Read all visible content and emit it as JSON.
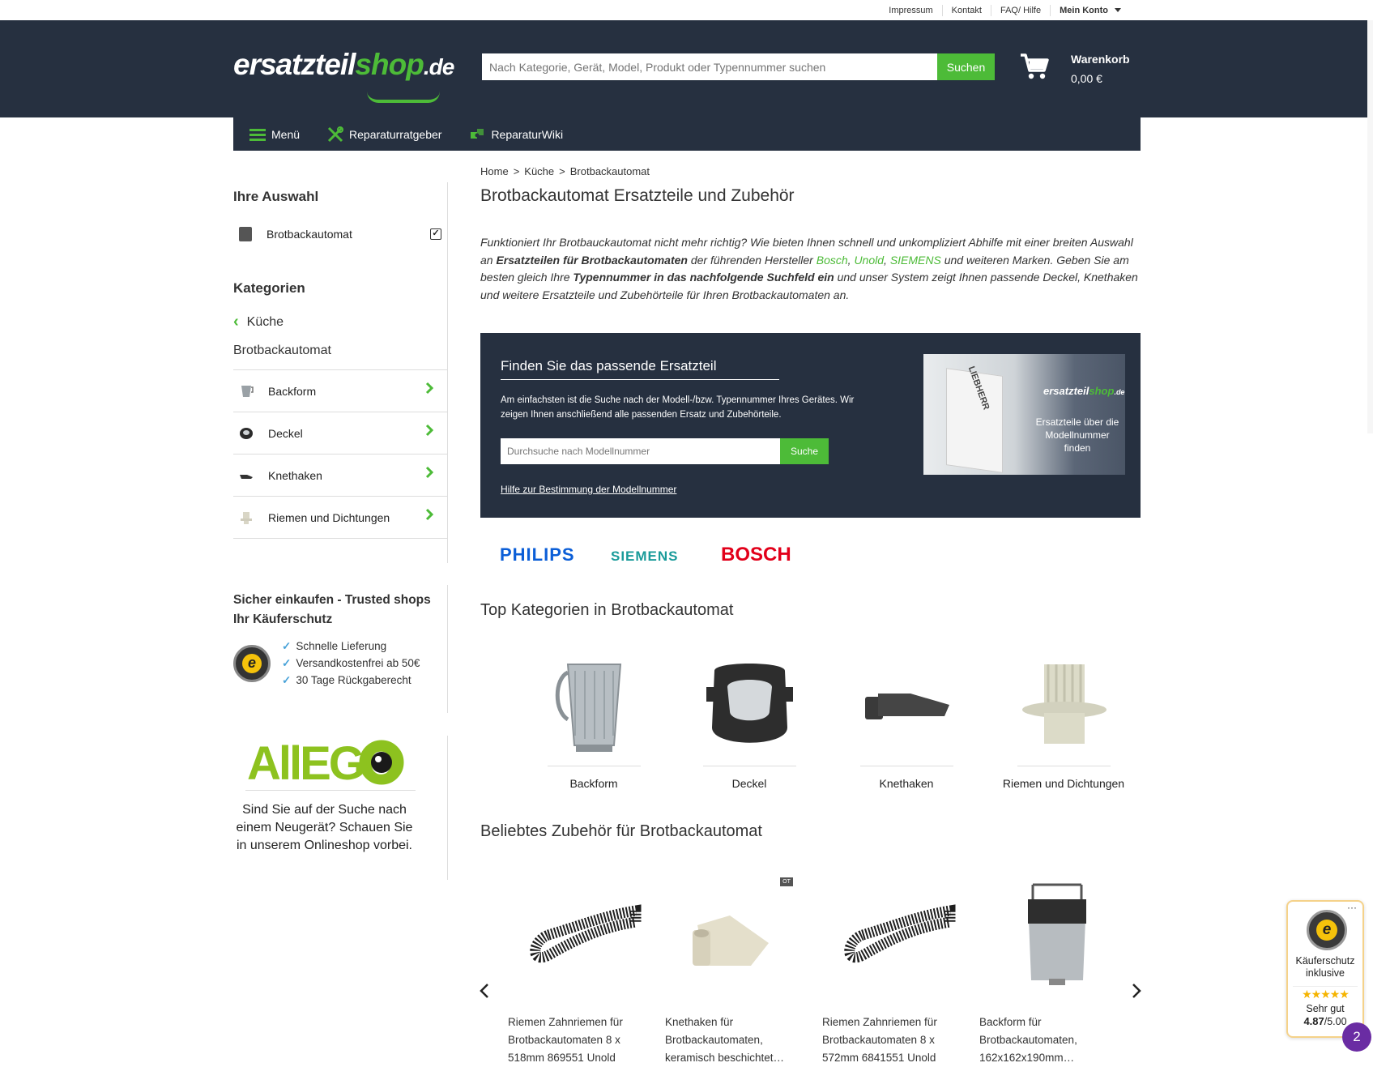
{
  "topbar": {
    "links": [
      "Impressum",
      "Kontakt",
      "FAQ/ Hilfe"
    ],
    "account": "Mein Konto"
  },
  "header": {
    "logo_main": "ersatzteil",
    "logo_shop": "shop",
    "logo_tld": ".de",
    "search_placeholder": "Nach Kategorie, Gerät, Model, Produkt oder Typennummer suchen",
    "search_button": "Suchen",
    "cart_label": "Warenkorb",
    "cart_total": "0,00 €"
  },
  "nav": {
    "menu": "Menü",
    "repair_guide": "Reparaturratgeber",
    "repair_wiki": "ReparaturWiki"
  },
  "breadcrumb": [
    "Home",
    "Küche",
    "Brotbackautomat"
  ],
  "sidebar": {
    "selection_heading": "Ihre Auswahl",
    "selection_item": "Brotbackautomat",
    "categories_heading": "Kategorien",
    "back_category": "Küche",
    "current_category": "Brotbackautomat",
    "categories": [
      {
        "label": "Backform"
      },
      {
        "label": "Deckel"
      },
      {
        "label": "Knethaken"
      },
      {
        "label": "Riemen und Dichtungen"
      }
    ],
    "trusted_heading": "Sicher einkaufen - Trusted shops Ihr Käuferschutz",
    "trusted_points": [
      "Schnelle Lieferung",
      "Versandkostenfrei ab 50€",
      "30 Tage Rückgaberecht"
    ],
    "allego_logo": "AllEGO",
    "allego_text": "Sind Sie auf der Suche nach einem Neugerät? Schauen Sie in unserem Onlineshop vorbei."
  },
  "main": {
    "title": "Brotbackautomat Ersatzteile und Zubehör",
    "intro": {
      "p1": "Funktioniert Ihr Brotbauckautomat nicht mehr richtig? Wie bieten Ihnen schnell und unkompliziert Abhilfe mit einer breiten Auswahl an ",
      "b1": "Ersatzteilen für Brotbackautomaten",
      "p2": " der führenden Hersteller ",
      "brand1": "Bosch",
      "comma1": ", ",
      "brand2": "Unold",
      "comma2": ", ",
      "brand3": "SIEMENS",
      "p3": " und weiteren Marken. Geben Sie am besten gleich Ihre ",
      "b2": "Typennummer in das nachfolgende Suchfeld ein",
      "p4": " und unser System zeigt Ihnen passende Deckel, Knethaken und weitere Ersatzteile und Zubehörteile für Ihren Brotbackautomaten an."
    },
    "finder": {
      "heading": "Finden Sie das passende Ersatzteil",
      "description": "Am einfachsten ist die Suche nach der Modell-/bzw. Typennummer Ihres Gerätes. Wir zeigen Ihnen anschließend alle passenden Ersatz und Zubehörteile.",
      "placeholder": "Durchsuche nach Modellnummer",
      "button": "Suche",
      "help_link": "Hilfe zur Bestimmung der Modellnummer",
      "promo_plate": "LIEBHERR",
      "promo_logo_main": "ersatzteil",
      "promo_logo_shop": "shop",
      "promo_logo_tld": ".de",
      "promo_text": "Ersatzteile über die Modellnummer finden"
    },
    "brands": [
      "PHILIPS",
      "SIEMENS",
      "BOSCH"
    ],
    "top_categories_heading": "Top Kategorien in Brotbackautomat",
    "top_categories": [
      {
        "label": "Backform",
        "icon": "baking-pan"
      },
      {
        "label": "Deckel",
        "icon": "lid"
      },
      {
        "label": "Knethaken",
        "icon": "kneading-hook"
      },
      {
        "label": "Riemen und Dichtungen",
        "icon": "gear-seal"
      }
    ],
    "accessories_heading": "Beliebtes Zubehör für Brotbackautomat",
    "badge": "OT",
    "products": [
      {
        "title": "Riemen Zahnriemen für Brotbackautomaten 8 x 518mm 869551 Unold"
      },
      {
        "title": "Knethaken für Brotbackautomaten, keramisch beschichtet…"
      },
      {
        "title": "Riemen Zahnriemen für Brotbackautomaten 8 x 572mm 6841551 Unold"
      },
      {
        "title": "Backform für Brotbackautomaten, 162x162x190mm…"
      }
    ]
  },
  "trusted_widget": {
    "label": "Käuferschutz inklusive",
    "stars": "★★★★★",
    "verdict": "Sehr gut",
    "score": "4.87",
    "scale": "/5.00",
    "bubble": "2"
  },
  "colors": {
    "brand_green": "#4dbb38",
    "header_navy": "#263040"
  }
}
